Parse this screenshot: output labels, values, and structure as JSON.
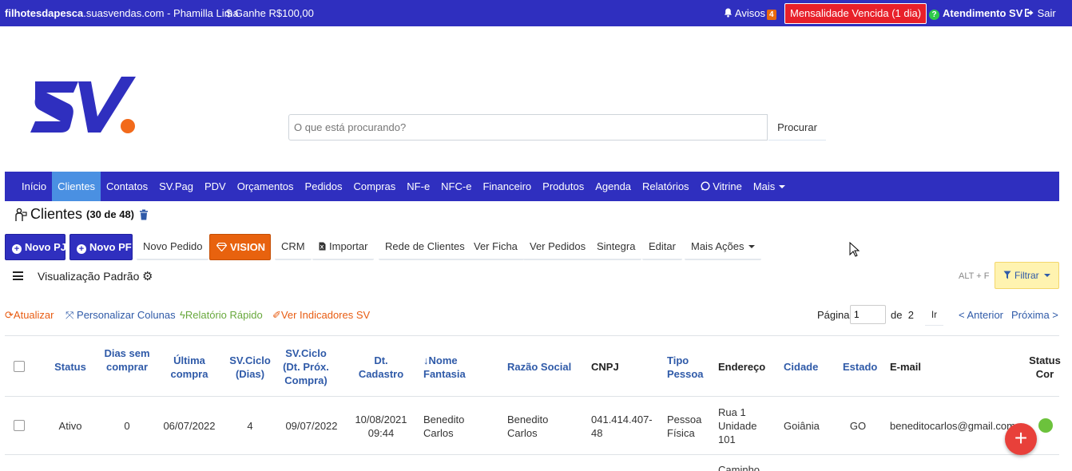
{
  "topbar": {
    "domain_bold": "filhotesdapesca",
    "domain_rest": ".suasvendas.com",
    "separator": "-",
    "user": "Phamilla Lima",
    "gain": "Ganhe R$100,00",
    "avisos_label": "Avisos",
    "avisos_count": "4",
    "mensalidade": "Mensalidade Vencida (1 dia)",
    "atendimento": "Atendimento SV",
    "sair": "Sair"
  },
  "search": {
    "placeholder": "O que está procurando?",
    "button": "Procurar"
  },
  "nav": {
    "items": [
      "Início",
      "Clientes",
      "Contatos",
      "SV.Pag",
      "PDV",
      "Orçamentos",
      "Pedidos",
      "Compras",
      "NF-e",
      "NFC-e",
      "Financeiro",
      "Produtos",
      "Agenda",
      "Relatórios",
      "Vitrine",
      "Mais"
    ],
    "active": "Clientes"
  },
  "page": {
    "title": "Clientes",
    "count": "(30 de 48)"
  },
  "actions": {
    "novo_pj": "Novo PJ",
    "novo_pf": "Novo PF",
    "novo_pedido": "Novo Pedido",
    "vision": "VISION",
    "crm": "CRM",
    "importar": "Importar",
    "rede": "Rede de Clientes",
    "ver_ficha": "Ver Ficha",
    "ver_pedidos": "Ver Pedidos",
    "sintegra": "Sintegra",
    "editar": "Editar",
    "mais_acoes": "Mais Ações"
  },
  "view": {
    "label": "Visualização Padrão",
    "shortcut": "ALT + F",
    "filter": "Filtrar"
  },
  "tools": {
    "atualizar": "Atualizar",
    "personalizar": "Personalizar Colunas",
    "relatorio": "Relatório Rápido",
    "indicadores": "Ver Indicadores SV"
  },
  "pagination": {
    "label": "Página",
    "current": "1",
    "of": "de",
    "total": "2",
    "go": "Ir",
    "prev": "< Anterior",
    "next": "Próxima >"
  },
  "table": {
    "headers": {
      "status": "Status",
      "dias": "Dias sem comprar",
      "ultima": "Última compra",
      "ciclo": "SV.Ciclo (Dias)",
      "ciclo_dt": "SV.Ciclo (Dt. Próx. Compra)",
      "cadastro": "Dt. Cadastro",
      "nome": "↓Nome Fantasia",
      "razao": "Razão Social",
      "cnpj": "CNPJ",
      "tipo": "Tipo Pessoa",
      "endereco": "Endereço",
      "cidade": "Cidade",
      "estado": "Estado",
      "email": "E-mail",
      "status_cor": "Status Cor"
    },
    "rows": [
      {
        "status": "Ativo",
        "dias": "0",
        "ultima": "06/07/2022",
        "ciclo": "4",
        "ciclo_dt": "09/07/2022",
        "cadastro": "10/08/2021 09:44",
        "nome": "Benedito Carlos",
        "razao": "Benedito Carlos",
        "cnpj": "041.414.407-48",
        "tipo": "Pessoa Física",
        "endereco": "Rua 1 Unidade 101",
        "cidade": "Goiânia",
        "estado": "GO",
        "email": "beneditocarlos@gmail.com",
        "status_color": "#6cc23c"
      }
    ],
    "next_row_partial": "Caminho"
  },
  "colors": {
    "brand_blue": "#2f2fbf",
    "brand_orange": "#e8620e",
    "alert_red": "#e8202a",
    "link_blue": "#2f5aa8"
  }
}
